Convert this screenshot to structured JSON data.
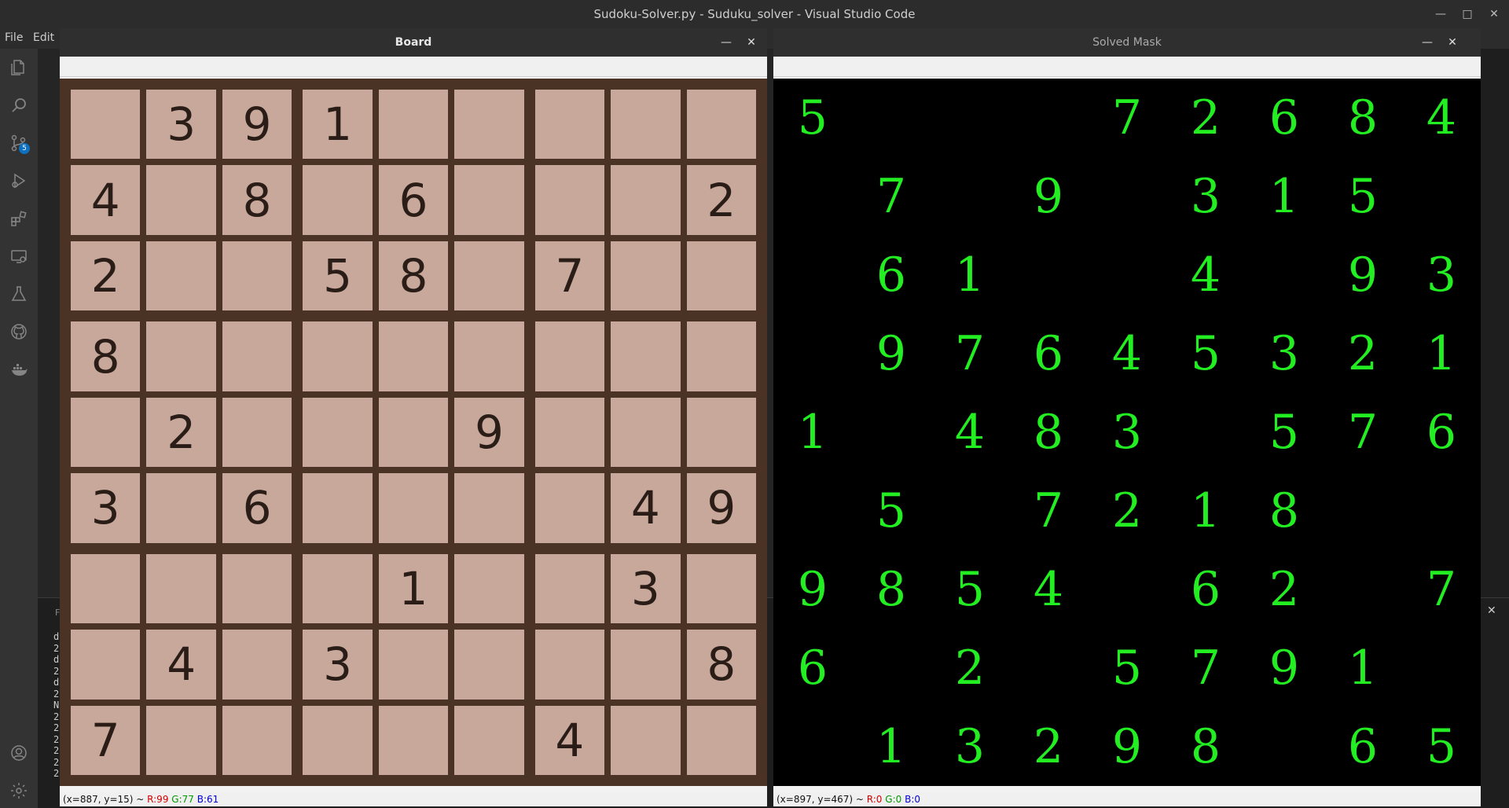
{
  "window_title": "Sudoku-Solver.py - Suduku_solver - Visual Studio Code",
  "menu": {
    "file": "File",
    "edit": "Edit"
  },
  "activity_bar": {
    "scm_badge": "5"
  },
  "board_window": {
    "title": "Board",
    "status": {
      "coords": "(x=887, y=15) ~ ",
      "r": "R:99",
      "g": "G:77",
      "b": "B:61"
    },
    "grid": [
      [
        "",
        "3",
        "9",
        "1",
        "",
        "",
        "",
        "",
        ""
      ],
      [
        "4",
        "",
        "8",
        "",
        "6",
        "",
        "",
        "",
        "2"
      ],
      [
        "2",
        "",
        "",
        "5",
        "8",
        "",
        "7",
        "",
        ""
      ],
      [
        "8",
        "",
        "",
        "",
        "",
        "",
        "",
        "",
        ""
      ],
      [
        "",
        "2",
        "",
        "",
        "",
        "9",
        "",
        "",
        ""
      ],
      [
        "3",
        "",
        "6",
        "",
        "",
        "",
        "",
        "4",
        "9"
      ],
      [
        "",
        "",
        "",
        "",
        "1",
        "",
        "",
        "3",
        ""
      ],
      [
        "",
        "4",
        "",
        "3",
        "",
        "",
        "",
        "",
        "8"
      ],
      [
        "7",
        "",
        "",
        "",
        "",
        "",
        "4",
        "",
        ""
      ]
    ]
  },
  "mask_window": {
    "title": "Solved Mask",
    "status": {
      "coords": "(x=897, y=467) ~ ",
      "r": "R:0",
      "g": "G:0",
      "b": "B:0"
    },
    "grid": [
      [
        "5",
        "",
        "",
        "",
        "7",
        "2",
        "6",
        "8",
        "4"
      ],
      [
        "",
        "7",
        "",
        "9",
        "",
        "3",
        "1",
        "5",
        ""
      ],
      [
        "",
        "6",
        "1",
        "",
        "",
        "4",
        "",
        "9",
        "3"
      ],
      [
        "",
        "9",
        "7",
        "6",
        "4",
        "5",
        "3",
        "2",
        "1"
      ],
      [
        "1",
        "",
        "4",
        "8",
        "3",
        "",
        "5",
        "7",
        "6"
      ],
      [
        "",
        "5",
        "",
        "7",
        "2",
        "1",
        "8",
        "",
        ""
      ],
      [
        "9",
        "8",
        "5",
        "4",
        "",
        "6",
        "2",
        "",
        "7"
      ],
      [
        "6",
        "",
        "2",
        "",
        "5",
        "7",
        "9",
        "1",
        ""
      ],
      [
        "",
        "1",
        "3",
        "2",
        "9",
        "8",
        "",
        "6",
        "5"
      ]
    ]
  },
  "terminal_lines": [
    "d",
    "2",
    "d",
    "2",
    "d",
    "2",
    "N",
    "2",
    "2",
    "2",
    "2",
    "2",
    "2"
  ],
  "icons": [
    "files-icon",
    "search-icon",
    "source-control-icon",
    "run-debug-icon",
    "extensions-icon",
    "remote-explorer-icon",
    "testing-icon",
    "github-icon",
    "docker-icon",
    "account-icon",
    "settings-gear-icon"
  ]
}
